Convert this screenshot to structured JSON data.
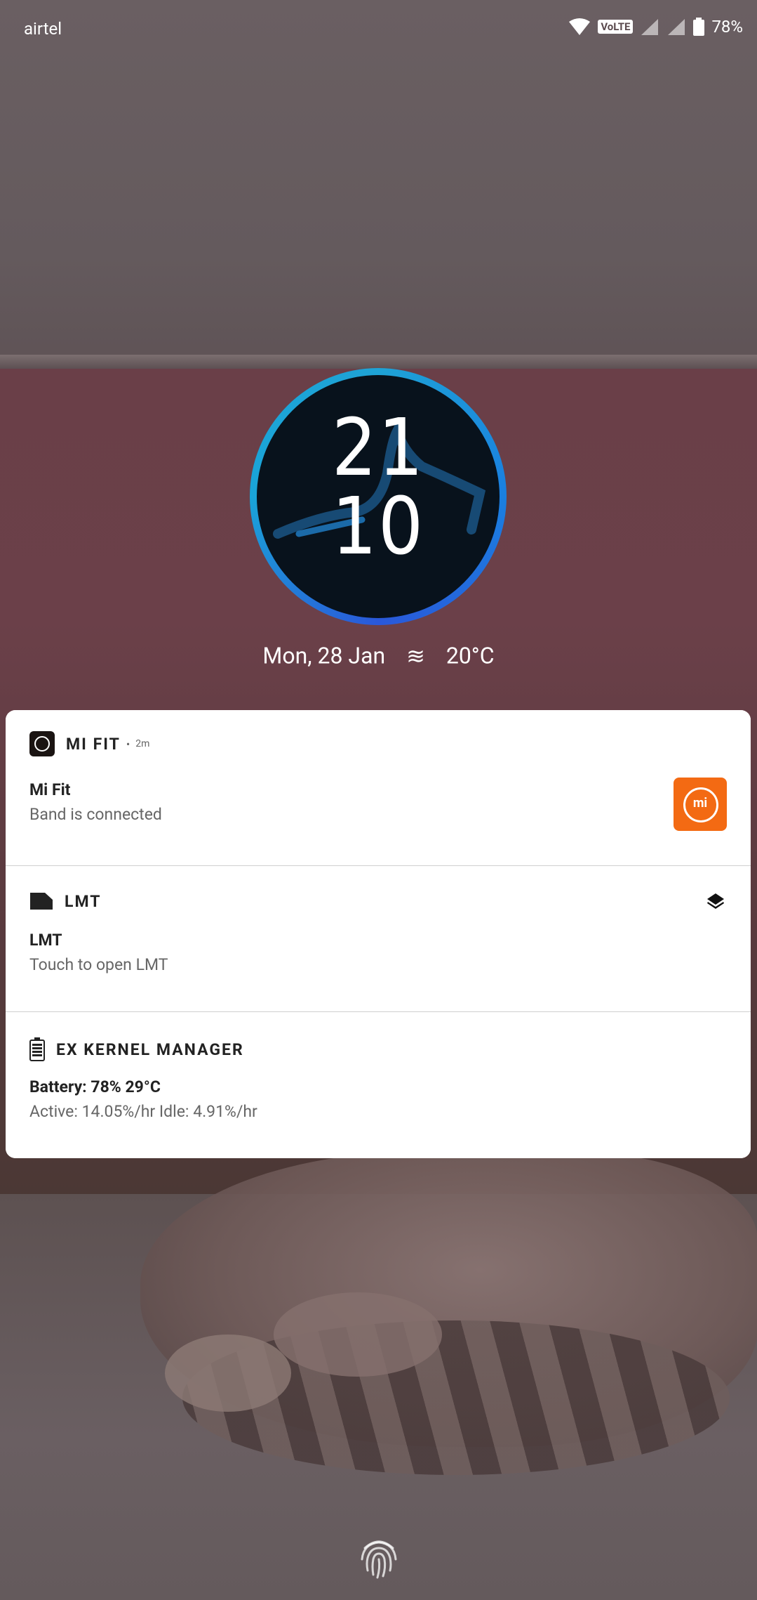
{
  "status_bar": {
    "carrier": "airtel",
    "volte_badge": "VoLTE",
    "battery_percent": "78%"
  },
  "clock": {
    "hour": "21",
    "minute": "10"
  },
  "date_weather": {
    "date": "Mon, 28 Jan",
    "weather_icon": "haze-icon",
    "temperature": "20°C"
  },
  "notifications": [
    {
      "app_name": "MI FIT",
      "time": "2m",
      "title": "Mi Fit",
      "text": "Band is connected",
      "large_icon": "mi-logo",
      "large_icon_text": "mi",
      "accent_color": "#f36a13"
    },
    {
      "app_name": "LMT",
      "title": "LMT",
      "text": "Touch to open LMT",
      "action_icon": "layers-icon"
    },
    {
      "app_name": "EX KERNEL MANAGER",
      "title": "Battery: 78%  29°C",
      "text": "Active:  14.05%/hr   Idle:  4.91%/hr"
    }
  ],
  "lockscreen": {
    "fingerprint_icon": "fingerprint-icon"
  }
}
